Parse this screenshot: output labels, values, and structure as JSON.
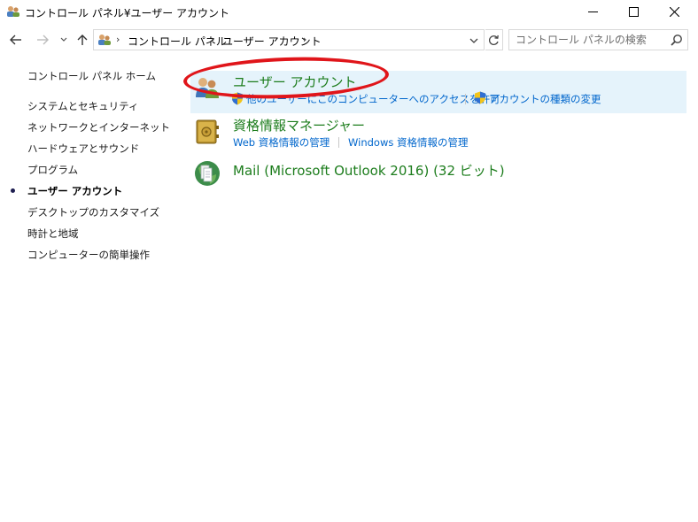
{
  "window": {
    "title": "コントロール パネル¥ユーザー アカウント",
    "app_icon": "control-panel-users-icon",
    "minimize_icon": "minimize-icon",
    "maximize_icon": "maximize-icon",
    "close_icon": "close-icon"
  },
  "navigation": {
    "back_icon": "back-arrow-icon",
    "forward_icon": "forward-arrow-icon",
    "recent_icon": "chevron-down-icon",
    "up_icon": "up-arrow-icon",
    "breadcrumb": [
      "コントロール パネル",
      "ユーザー アカウント"
    ],
    "refresh_icon": "refresh-icon",
    "search_placeholder": "コントロール パネルの検索",
    "search_icon": "search-icon"
  },
  "sidebar": {
    "home": "コントロール パネル ホーム",
    "items": [
      {
        "label": "システムとセキュリティ",
        "active": false
      },
      {
        "label": "ネットワークとインターネット",
        "active": false
      },
      {
        "label": "ハードウェアとサウンド",
        "active": false
      },
      {
        "label": "プログラム",
        "active": false
      },
      {
        "label": "ユーザー アカウント",
        "active": true
      },
      {
        "label": "デスクトップのカスタマイズ",
        "active": false
      },
      {
        "label": "時計と地域",
        "active": false
      },
      {
        "label": "コンピューターの簡単操作",
        "active": false
      }
    ]
  },
  "categories": [
    {
      "title": "ユーザー アカウント",
      "icon": "user-accounts-icon",
      "tasks": [
        {
          "label": "他のユーザーにこのコンピューターへのアクセスを許可",
          "icon": "uac-shield-icon"
        },
        {
          "label": "アカウントの種類の変更",
          "icon": "uac-shield-icon"
        }
      ]
    },
    {
      "title": "資格情報マネージャー",
      "icon": "credential-manager-icon",
      "tasks": [
        {
          "label": "Web 資格情報の管理"
        },
        {
          "label": "Windows 資格情報の管理"
        }
      ]
    },
    {
      "title": "Mail (Microsoft Outlook 2016) (32 ビット)",
      "icon": "mail-icon",
      "tasks": []
    }
  ],
  "colors": {
    "category_title": "#1d7d1d",
    "link": "#0066cc",
    "highlight": "#e5f3fb",
    "annotation": "#e0151a"
  }
}
